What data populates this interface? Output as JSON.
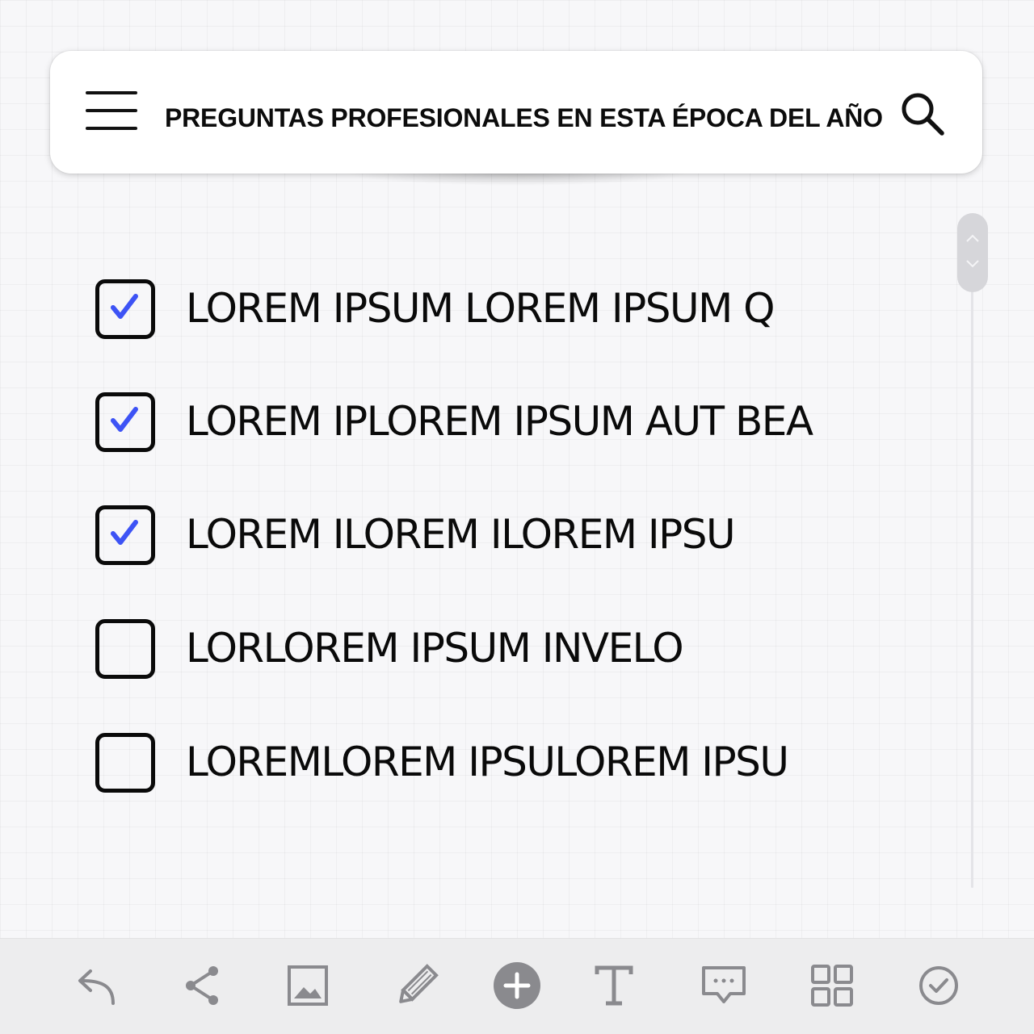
{
  "header": {
    "title": "PREGUNTAS PROFESIONALES EN ESTA ÉPOCA DEL AÑO",
    "menu_icon": "hamburger-menu-icon",
    "search_icon": "search-icon"
  },
  "checklist": {
    "items": [
      {
        "label": "LOREM IPSUM LOREM IPSUM Q",
        "checked": true
      },
      {
        "label": "LOREM IPLOREM IPSUM AUT BEA",
        "checked": true
      },
      {
        "label": "LOREM ILOREM ILOREM IPSU",
        "checked": true
      },
      {
        "label": "LORLOREM IPSUM INVELO",
        "checked": false
      },
      {
        "label": "LOREMLOREM IPSULOREM IPSU",
        "checked": false
      }
    ]
  },
  "toolbar": {
    "buttons": [
      "undo-icon",
      "share-icon",
      "image-icon",
      "pencil-icon",
      "add-icon",
      "text-icon",
      "comment-icon",
      "grid-icon",
      "done-icon"
    ]
  },
  "colors": {
    "check_mark": "#3d53f5",
    "toolbar_bg": "#ededee",
    "toolbar_icon": "#8a8a8e",
    "text": "#0a0a0a"
  }
}
